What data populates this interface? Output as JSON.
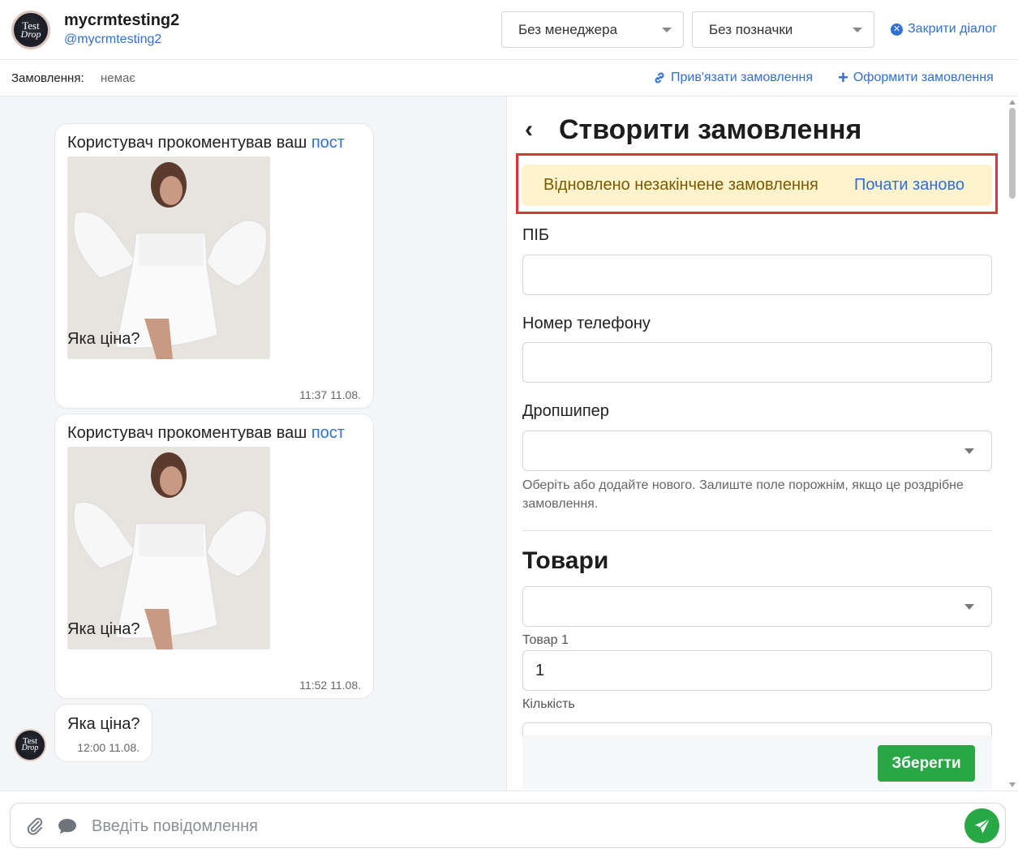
{
  "header": {
    "user_name": "mycrmtesting2",
    "user_handle": "@mycrmtesting2",
    "avatar_text_1": "Test",
    "avatar_text_2": "Drop",
    "manager_select": "Без менеджера",
    "label_select": "Без позначки",
    "close_dialog": "Закрити діалог"
  },
  "orders_bar": {
    "label": "Замовлення:",
    "value": "немає",
    "link_order": "Прив'язати замовлення",
    "create_order": "Оформити замовлення"
  },
  "chat": {
    "messages": [
      {
        "text_prefix": "Користувач прокоментував ваш",
        "post_link": "пост",
        "caption": "Яка ціна?",
        "time": "11:37 11.08."
      },
      {
        "text_prefix": "Користувач прокоментував ваш",
        "post_link": "пост",
        "caption": "Яка ціна?",
        "time": "11:52 11.08."
      },
      {
        "caption": "Яка ціна?",
        "time": "12:00 11.08."
      }
    ]
  },
  "order_panel": {
    "title": "Створити замовлення",
    "alert_text": "Відновлено незакінчене замовлення",
    "alert_link": "Почати заново",
    "fields": {
      "full_name_label": "ПІБ",
      "full_name_value": "",
      "phone_label": "Номер телефону",
      "phone_value": "",
      "dropshipper_label": "Дропшипер",
      "dropshipper_hint": "Оберіть або додайте нового. Залиште поле порожнім, якщо це роздрібне замовлення."
    },
    "products_title": "Товари",
    "product_label": "Товар 1",
    "quantity_value": "1",
    "quantity_label": "Кількість",
    "save_button": "Зберегти"
  },
  "composer": {
    "placeholder": "Введіть повідомлення"
  },
  "colors": {
    "accent": "#2f6fd6",
    "success": "#28a745",
    "alert_bg": "#fff3cd",
    "highlight": "#e0352b"
  }
}
